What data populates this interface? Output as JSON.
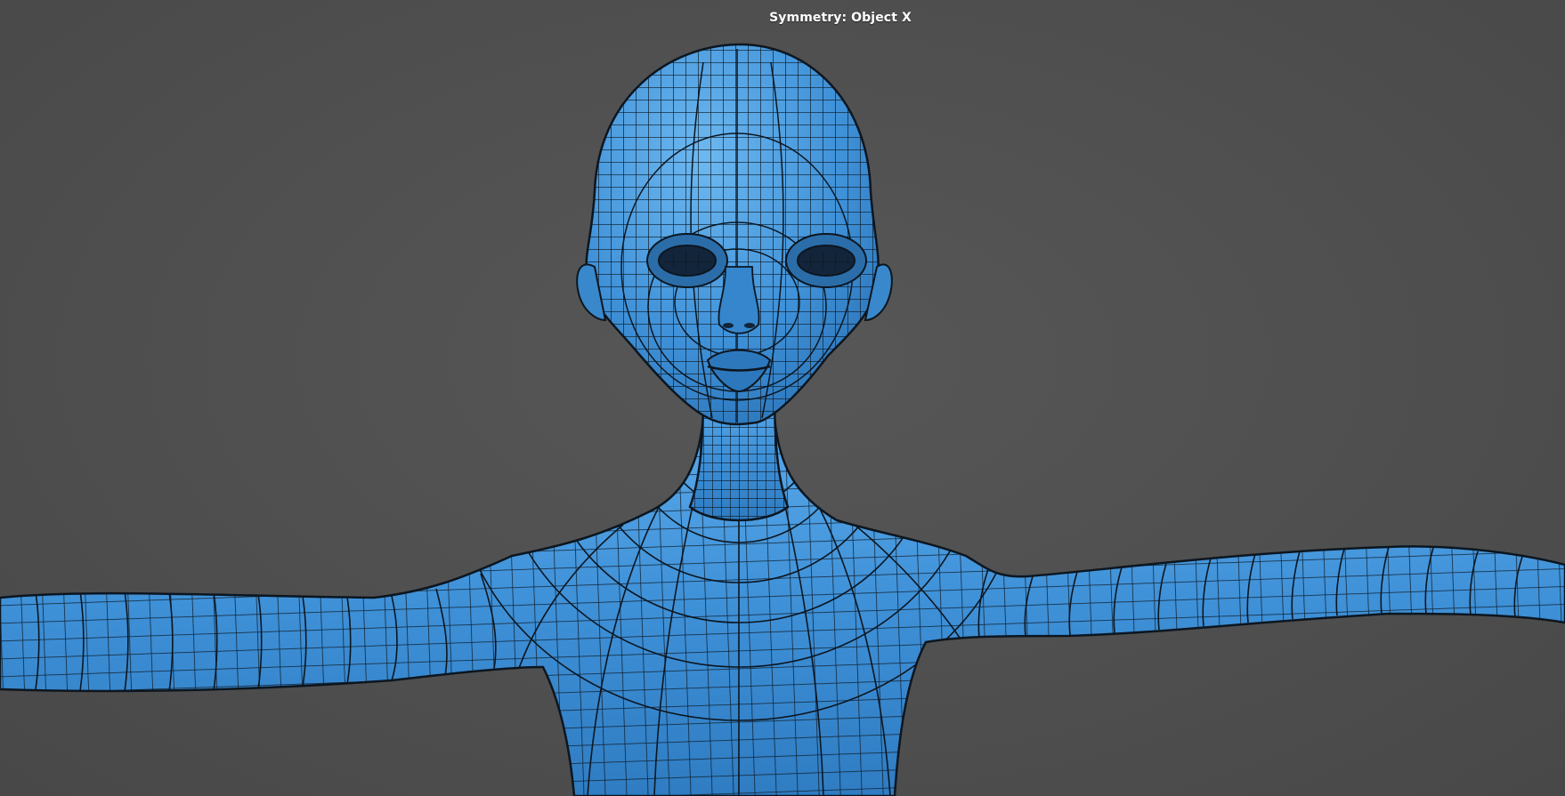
{
  "viewport": {
    "hud_text": "Symmetry: Object X",
    "background_color": "#505050"
  },
  "model": {
    "shading_color": "#3d8fd6",
    "highlight_color": "#6cb6ef",
    "wireframe_color": "#0c1620",
    "display_mode": "wireframe-on-shaded"
  }
}
